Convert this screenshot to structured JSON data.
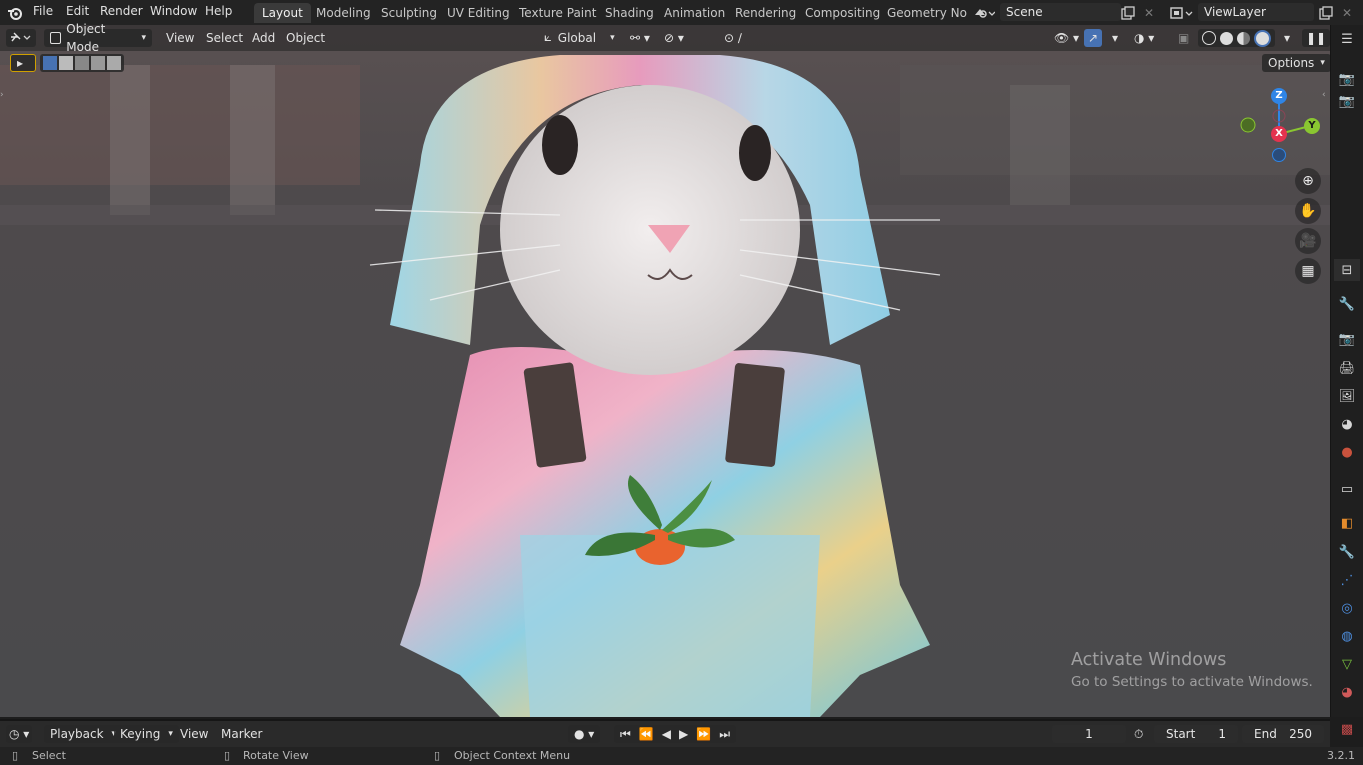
{
  "app": {
    "name": "Blender",
    "version": "3.2.1"
  },
  "topbar": {
    "menus": [
      "File",
      "Edit",
      "Render",
      "Window",
      "Help"
    ],
    "workspaces": [
      "Layout",
      "Modeling",
      "Sculpting",
      "UV Editing",
      "Texture Paint",
      "Shading",
      "Animation",
      "Rendering",
      "Compositing",
      "Geometry Noc"
    ],
    "active_workspace": "Layout",
    "scene": "Scene",
    "view_layer": "ViewLayer"
  },
  "viewport_header": {
    "mode": "Object Mode",
    "menus": [
      "View",
      "Select",
      "Add",
      "Object"
    ],
    "transform_orientation": "Global",
    "options_label": "Options"
  },
  "gizmo": {
    "z": "Z",
    "y": "Y",
    "x": "X"
  },
  "watermark": {
    "title": "Activate Windows",
    "subtitle": "Go to Settings to activate Windows."
  },
  "timeline": {
    "menus": [
      "Playback",
      "Keying",
      "View",
      "Marker"
    ],
    "current_frame": "1",
    "start_label": "Start",
    "start_value": "1",
    "end_label": "End",
    "end_value": "250"
  },
  "statusbar": {
    "select": "Select",
    "rotate": "Rotate View",
    "context": "Object Context Menu",
    "version": "3.2.1"
  },
  "colors": {
    "accent": "#4772b3",
    "axis_x": "#e4334e",
    "axis_y": "#8ac631",
    "axis_z": "#2f85e6"
  }
}
